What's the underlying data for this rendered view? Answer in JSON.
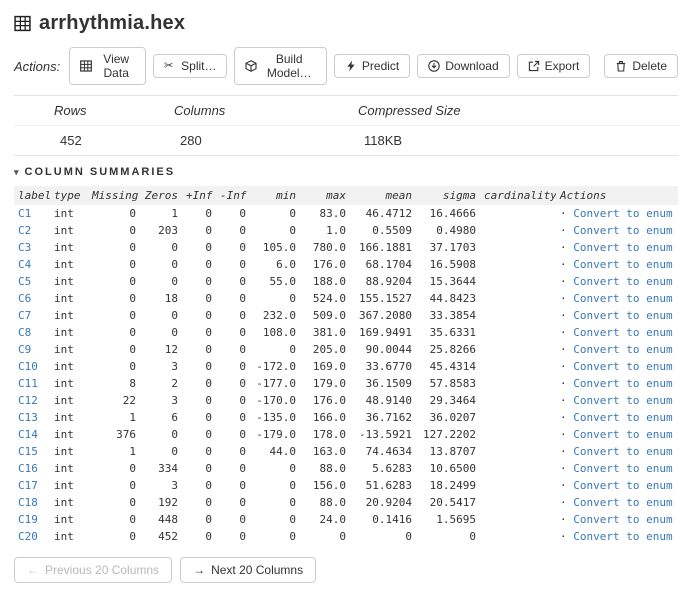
{
  "page": {
    "title": "arrhythmia.hex"
  },
  "actions_bar": {
    "label": "Actions:",
    "buttons": [
      {
        "name": "view-data",
        "icon": "grid-icon",
        "label": "View Data"
      },
      {
        "name": "split",
        "icon": "scissors-icon",
        "label": "Split…"
      },
      {
        "name": "build-model",
        "icon": "cube-icon",
        "label": "Build Model…"
      },
      {
        "name": "predict",
        "icon": "bolt-icon",
        "label": "Predict"
      },
      {
        "name": "download",
        "icon": "download-icon",
        "label": "Download"
      },
      {
        "name": "export",
        "icon": "export-icon",
        "label": "Export"
      }
    ],
    "delete_button": {
      "icon": "trash-icon",
      "label": "Delete"
    }
  },
  "overview": {
    "headers": [
      "Rows",
      "Columns",
      "Compressed Size"
    ],
    "values": [
      "452",
      "280",
      "118KB"
    ]
  },
  "section": {
    "collapse_icon": "▾",
    "title": "COLUMN SUMMARIES"
  },
  "summaries": {
    "headers": [
      "label",
      "type",
      "Missing",
      "Zeros",
      "+Inf",
      "-Inf",
      "min",
      "max",
      "mean",
      "sigma",
      "cardinality",
      "Actions"
    ],
    "action_dot": "·",
    "action_label": "Convert to enum",
    "rows": [
      [
        "C1",
        "int",
        "0",
        "1",
        "0",
        "0",
        "0",
        "83.0",
        "46.4712",
        "16.4666"
      ],
      [
        "C2",
        "int",
        "0",
        "203",
        "0",
        "0",
        "0",
        "1.0",
        "0.5509",
        "0.4980"
      ],
      [
        "C3",
        "int",
        "0",
        "0",
        "0",
        "0",
        "105.0",
        "780.0",
        "166.1881",
        "37.1703"
      ],
      [
        "C4",
        "int",
        "0",
        "0",
        "0",
        "0",
        "6.0",
        "176.0",
        "68.1704",
        "16.5908"
      ],
      [
        "C5",
        "int",
        "0",
        "0",
        "0",
        "0",
        "55.0",
        "188.0",
        "88.9204",
        "15.3644"
      ],
      [
        "C6",
        "int",
        "0",
        "18",
        "0",
        "0",
        "0",
        "524.0",
        "155.1527",
        "44.8423"
      ],
      [
        "C7",
        "int",
        "0",
        "0",
        "0",
        "0",
        "232.0",
        "509.0",
        "367.2080",
        "33.3854"
      ],
      [
        "C8",
        "int",
        "0",
        "0",
        "0",
        "0",
        "108.0",
        "381.0",
        "169.9491",
        "35.6331"
      ],
      [
        "C9",
        "int",
        "0",
        "12",
        "0",
        "0",
        "0",
        "205.0",
        "90.0044",
        "25.8266"
      ],
      [
        "C10",
        "int",
        "0",
        "3",
        "0",
        "0",
        "-172.0",
        "169.0",
        "33.6770",
        "45.4314"
      ],
      [
        "C11",
        "int",
        "8",
        "2",
        "0",
        "0",
        "-177.0",
        "179.0",
        "36.1509",
        "57.8583"
      ],
      [
        "C12",
        "int",
        "22",
        "3",
        "0",
        "0",
        "-170.0",
        "176.0",
        "48.9140",
        "29.3464"
      ],
      [
        "C13",
        "int",
        "1",
        "6",
        "0",
        "0",
        "-135.0",
        "166.0",
        "36.7162",
        "36.0207"
      ],
      [
        "C14",
        "int",
        "376",
        "0",
        "0",
        "0",
        "-179.0",
        "178.0",
        "-13.5921",
        "127.2202"
      ],
      [
        "C15",
        "int",
        "1",
        "0",
        "0",
        "0",
        "44.0",
        "163.0",
        "74.4634",
        "13.8707"
      ],
      [
        "C16",
        "int",
        "0",
        "334",
        "0",
        "0",
        "0",
        "88.0",
        "5.6283",
        "10.6500"
      ],
      [
        "C17",
        "int",
        "0",
        "3",
        "0",
        "0",
        "0",
        "156.0",
        "51.6283",
        "18.2499"
      ],
      [
        "C18",
        "int",
        "0",
        "192",
        "0",
        "0",
        "0",
        "88.0",
        "20.9204",
        "20.5417"
      ],
      [
        "C19",
        "int",
        "0",
        "448",
        "0",
        "0",
        "0",
        "24.0",
        "0.1416",
        "1.5695"
      ],
      [
        "C20",
        "int",
        "0",
        "452",
        "0",
        "0",
        "0",
        "0",
        "0",
        "0"
      ]
    ]
  },
  "pagination": {
    "prev": {
      "icon": "←",
      "label": "Previous 20 Columns",
      "enabled": false
    },
    "next": {
      "icon": "→",
      "label": "Next 20 Columns",
      "enabled": true
    }
  },
  "colors": {
    "link": "#3878ba",
    "table_header_bg": "#f2f2f2",
    "border": "#cccccc",
    "disabled_text": "#b8b8b8"
  }
}
